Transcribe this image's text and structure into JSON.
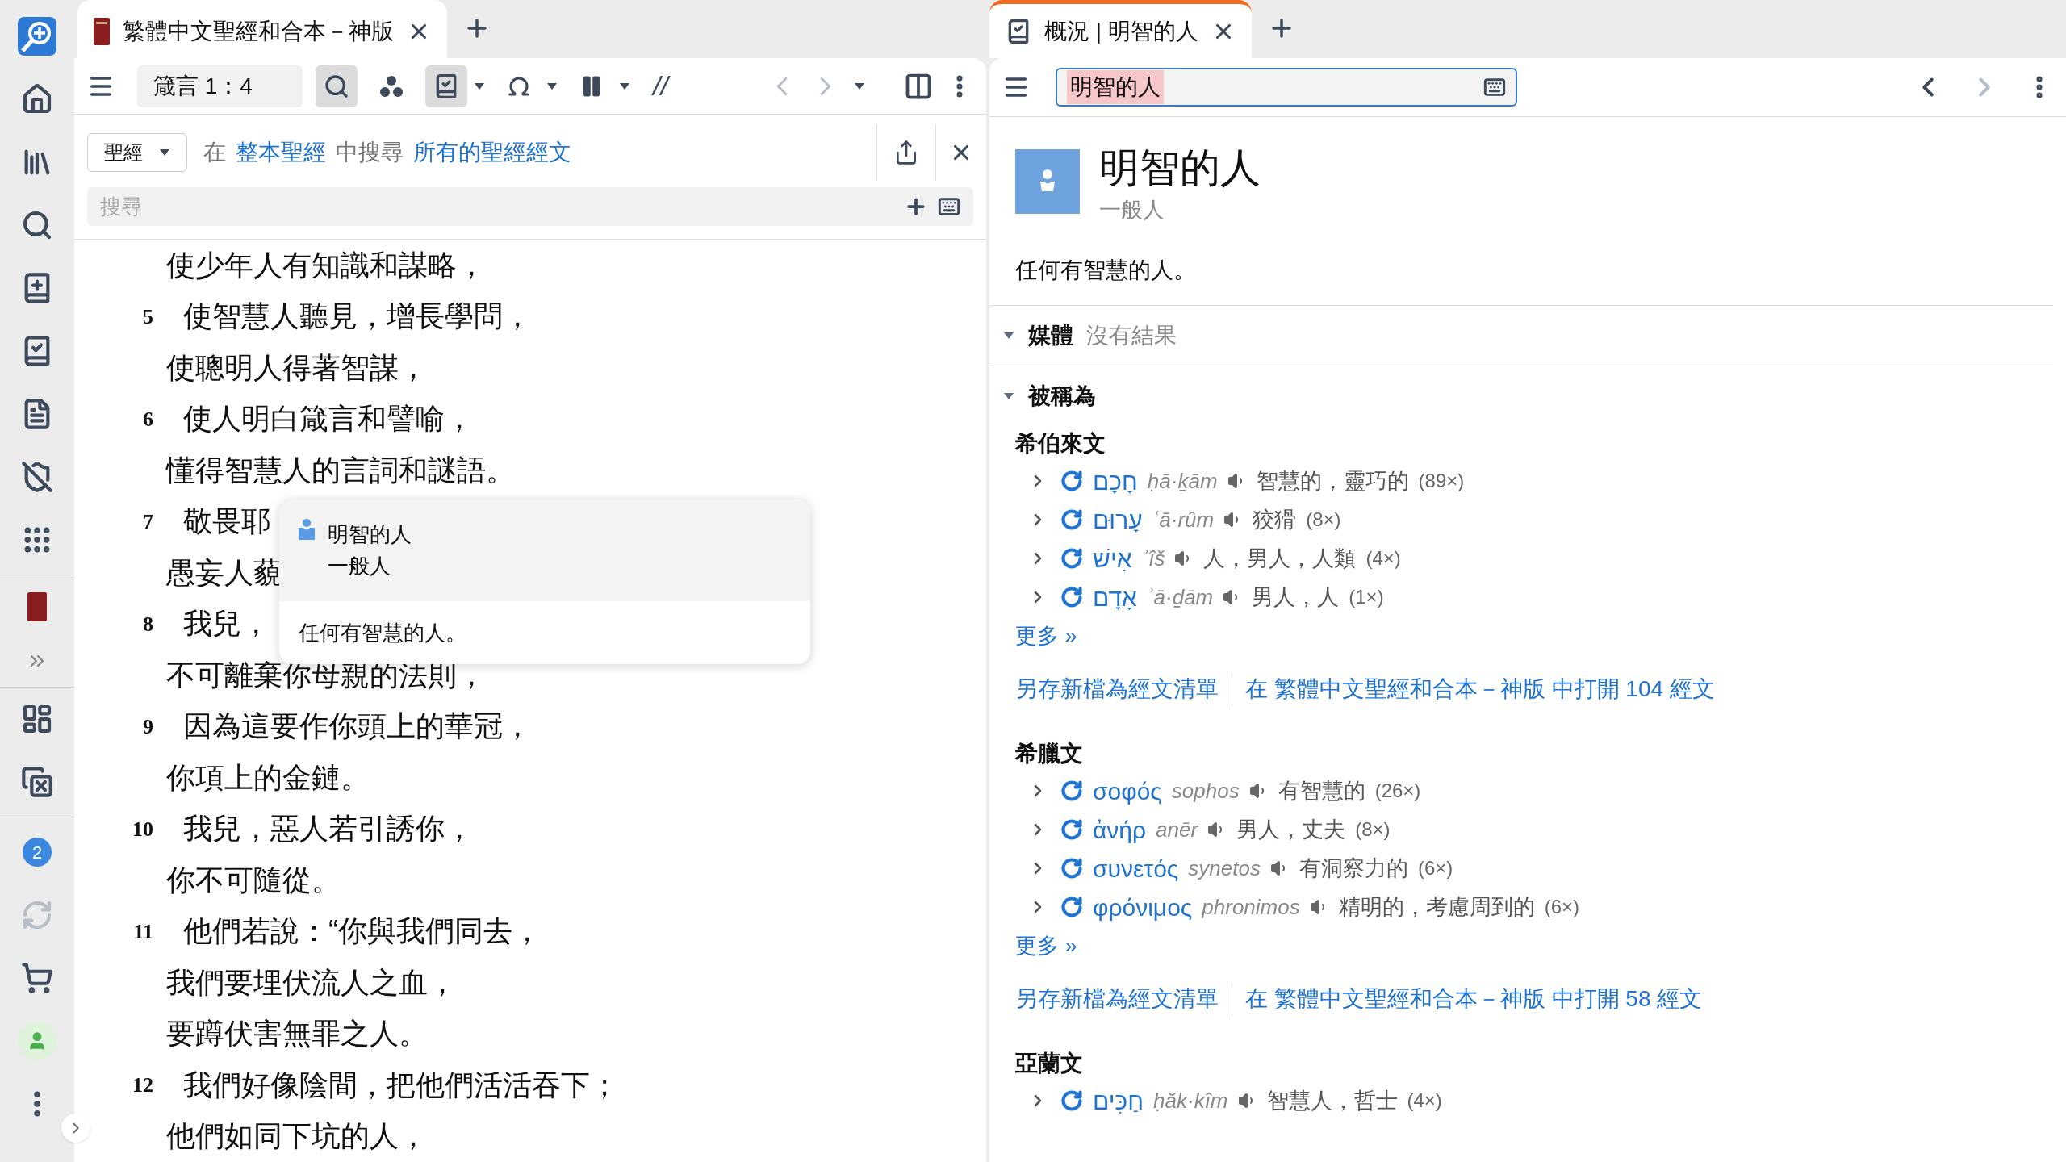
{
  "sidebar": {
    "badge": "2"
  },
  "left_pane": {
    "tab": {
      "title": "繁體中文聖經和合本－神版",
      "selected": true,
      "focused": false
    },
    "reference": "箴言 1：4",
    "tools": [
      {
        "kind": "search",
        "on": true,
        "menu": false
      },
      {
        "kind": "visual",
        "on": false,
        "menu": false
      },
      {
        "kind": "notes",
        "on": true,
        "menu": true
      },
      {
        "kind": "interlinear",
        "on": false,
        "menu": true
      },
      {
        "kind": "columns",
        "on": false,
        "menu": true
      },
      {
        "kind": "parallel",
        "label": "//"
      }
    ],
    "search": {
      "scope": "聖經",
      "parts": [
        {
          "kind": "text",
          "text": "在"
        },
        {
          "kind": "link",
          "text": "整本聖經"
        },
        {
          "kind": "text",
          "text": "中搜尋"
        },
        {
          "kind": "link",
          "text": "所有的聖經經文"
        }
      ],
      "placeholder": "搜尋"
    },
    "lines": [
      {
        "text": "使少年人有知識和謀略，"
      },
      {
        "number": "5",
        "text": "使智慧人聽見，增長學問，"
      },
      {
        "text": "使聰明人得著智謀，"
      },
      {
        "number": "6",
        "text": "使人明白箴言和譬喻，"
      },
      {
        "text": "懂得智慧人的言詞和謎語。"
      },
      {
        "number": "7",
        "text": "敬畏耶"
      },
      {
        "text": "愚妄人藐"
      },
      {
        "number": "8",
        "text": "我兒，"
      },
      {
        "text": "不可離棄你母親的法則，"
      },
      {
        "number": "9",
        "text": "因為這要作你頭上的華冠，"
      },
      {
        "text": "你項上的金鏈。"
      },
      {
        "number": "10",
        "text": "我兒，惡人若引誘你，"
      },
      {
        "text": "你不可隨從。"
      },
      {
        "number": "11",
        "text": "他們若說：“你與我們同去，"
      },
      {
        "text": "我們要埋伏流人之血，"
      },
      {
        "text": "要蹲伏害無罪之人。"
      },
      {
        "number": "12",
        "text": "我們好像陰間，把他們活活吞下；"
      },
      {
        "text": "他們如同下坑的人，"
      }
    ],
    "popup": {
      "title": "明智的人",
      "subtitle": "一般人",
      "description": "任何有智慧的人。"
    }
  },
  "right_pane": {
    "tab": {
      "title": "概況 | 明智的人",
      "selected": true,
      "focused": true
    },
    "search_value": "明智的人",
    "title": "明智的人",
    "subtitle": "一般人",
    "description": "任何有智慧的人。",
    "sections": [
      {
        "title": "媒體",
        "note": "沒有結果",
        "expanded": true
      },
      {
        "title": "被稱為",
        "expanded": true,
        "groups": [
          {
            "language": "希伯來文",
            "entries": [
              {
                "word": "חָכָם",
                "translit": "ḥā·ḵām",
                "gloss": "智慧的，靈巧的",
                "count": "(89×)"
              },
              {
                "word": "עָרוּם",
                "translit": "ʿā·rûm",
                "gloss": "狡猾",
                "count": "(8×)"
              },
              {
                "word": "אִישׁ",
                "translit": "ʾîš",
                "gloss": "人，男人，人類",
                "count": "(4×)"
              },
              {
                "word": "אָדָם",
                "translit": "ʾā·ḏām",
                "gloss": "男人，人",
                "count": "(1×)"
              }
            ],
            "more": "更多 »",
            "actions": [
              "另存新檔為經文清單",
              "在 繁體中文聖經和合本－神版 中打開 104 經文"
            ]
          },
          {
            "language": "希臘文",
            "entries": [
              {
                "word": "σοφός",
                "translit": "sophos",
                "gloss": "有智慧的",
                "count": "(26×)"
              },
              {
                "word": "ἀνήρ",
                "translit": "anēr",
                "gloss": "男人，丈夫",
                "count": "(8×)"
              },
              {
                "word": "συνετός",
                "translit": "synetos",
                "gloss": "有洞察力的",
                "count": "(6×)"
              },
              {
                "word": "φρόνιμος",
                "translit": "phronimos",
                "gloss": "精明的，考慮周到的",
                "count": "(6×)"
              }
            ],
            "more": "更多 »",
            "actions": [
              "另存新檔為經文清單",
              "在 繁體中文聖經和合本－神版 中打開 58 經文"
            ]
          },
          {
            "language": "亞蘭文",
            "entries": [
              {
                "word": "חַכִּים",
                "translit": "ḥăk·kîm",
                "gloss": "智慧人，哲士",
                "count": "(4×)"
              }
            ]
          }
        ]
      }
    ]
  }
}
